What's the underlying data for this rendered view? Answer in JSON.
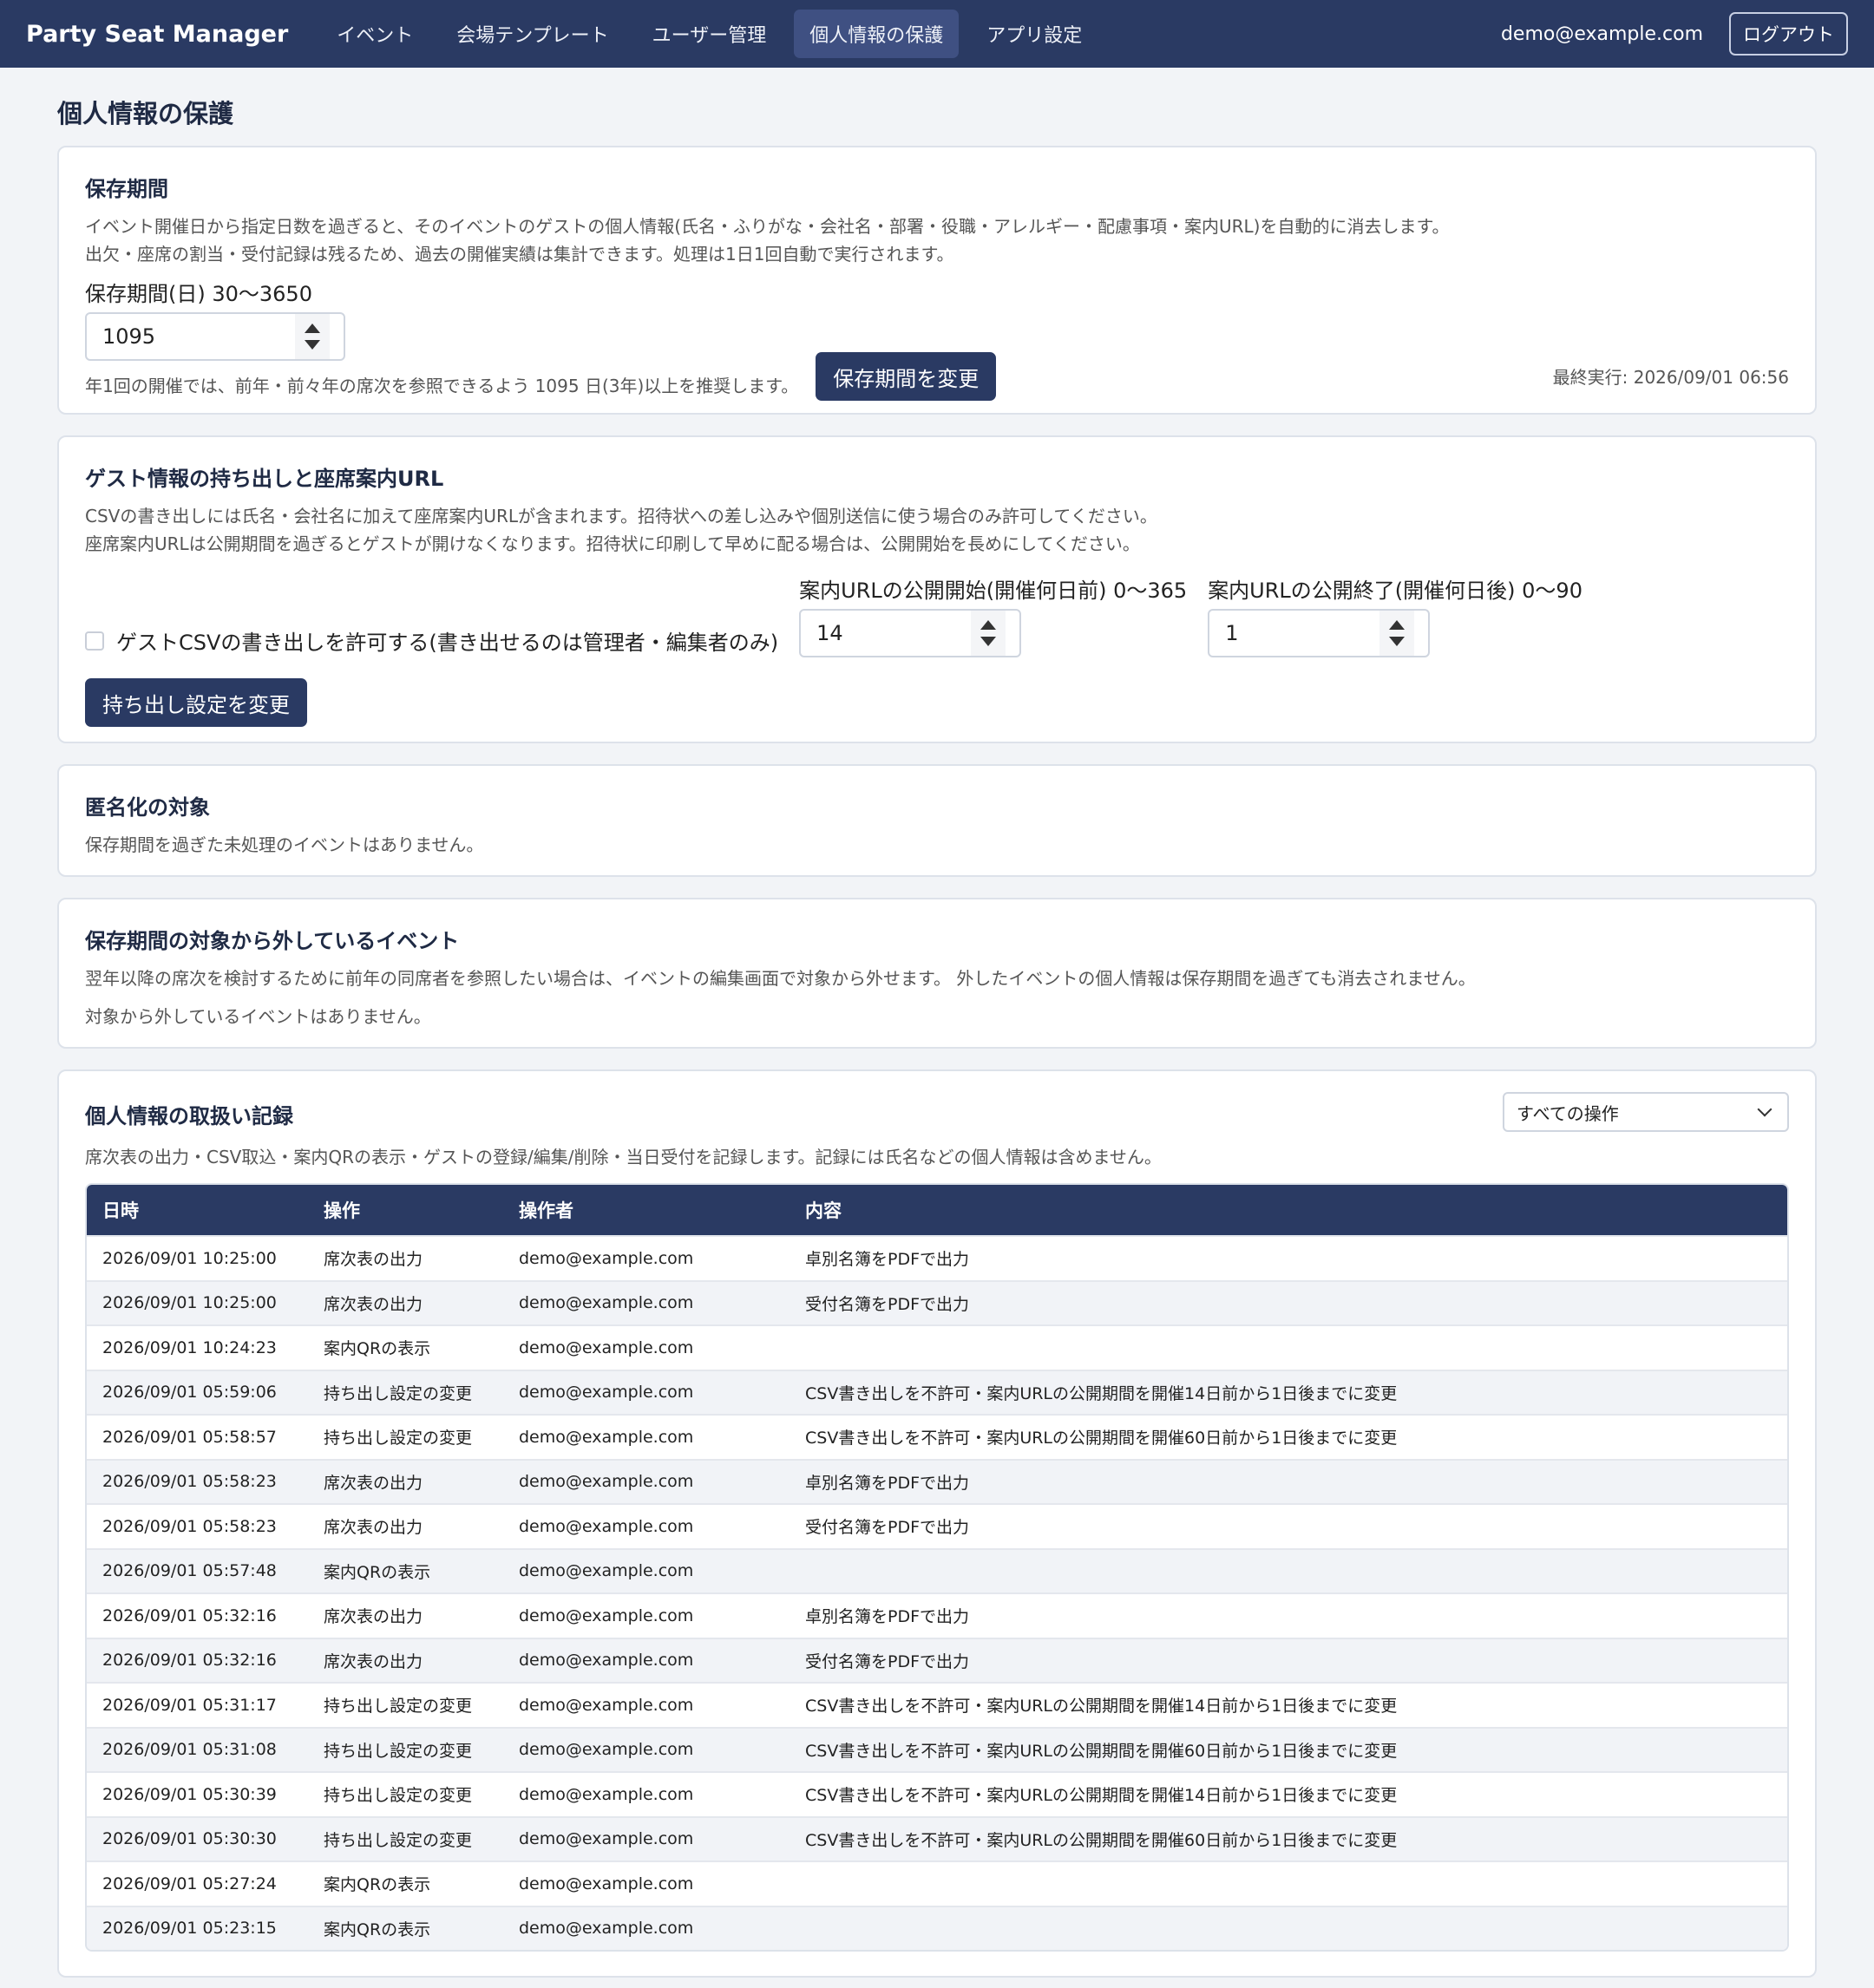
{
  "nav": {
    "brand": "Party Seat Manager",
    "items": [
      "イベント",
      "会場テンプレート",
      "ユーザー管理",
      "個人情報の保護",
      "アプリ設定"
    ],
    "active_index": 3,
    "user": "demo@example.com",
    "logout": "ログアウト"
  },
  "page_title": "個人情報の保護",
  "retention": {
    "title": "保存期間",
    "desc1": "イベント開催日から指定日数を過ぎると、そのイベントのゲストの個人情報(氏名・ふりがな・会社名・部署・役職・アレルギー・配慮事項・案内URL)を自動的に消去します。",
    "desc2": "出欠・座席の割当・受付記録は残るため、過去の開催実績は集計できます。処理は1日1回自動で実行されます。",
    "field_label": "保存期間(日) 30〜3650",
    "value": "1095",
    "hint": "年1回の開催では、前年・前々年の席次を参照できるよう 1095 日(3年)以上を推奨します。",
    "button": "保存期間を変更",
    "last_run": "最終実行: 2026/09/01 06:56"
  },
  "export": {
    "title": "ゲスト情報の持ち出しと座席案内URL",
    "desc1": "CSVの書き出しには氏名・会社名に加えて座席案内URLが含まれます。招待状への差し込みや個別送信に使う場合のみ許可してください。",
    "desc2": "座席案内URLは公開期間を過ぎるとゲストが開けなくなります。招待状に印刷して早めに配る場合は、公開開始を長めにしてください。",
    "checkbox_label": "ゲストCSVの書き出しを許可する(書き出せるのは管理者・編集者のみ)",
    "checked": false,
    "start_label": "案内URLの公開開始(開催何日前) 0〜365",
    "start_value": "14",
    "end_label": "案内URLの公開終了(開催何日後) 0〜90",
    "end_value": "1",
    "button": "持ち出し設定を変更"
  },
  "anonymize": {
    "title": "匿名化の対象",
    "desc": "保存期間を過ぎた未処理のイベントはありません。"
  },
  "excluded": {
    "title": "保存期間の対象から外しているイベント",
    "desc": "翌年以降の席次を検討するために前年の同席者を参照したい場合は、イベントの編集画面で対象から外せます。 外したイベントの個人情報は保存期間を過ぎても消去されません。",
    "empty": "対象から外しているイベントはありません。"
  },
  "log": {
    "title": "個人情報の取扱い記録",
    "filter": "すべての操作",
    "desc": "席次表の出力・CSV取込・案内QRの表示・ゲストの登録/編集/削除・当日受付を記録します。記録には氏名などの個人情報は含めません。",
    "headers": [
      "日時",
      "操作",
      "操作者",
      "内容"
    ],
    "rows": [
      [
        "2026/09/01 10:25:00",
        "席次表の出力",
        "demo@example.com",
        "卓別名簿をPDFで出力"
      ],
      [
        "2026/09/01 10:25:00",
        "席次表の出力",
        "demo@example.com",
        "受付名簿をPDFで出力"
      ],
      [
        "2026/09/01 10:24:23",
        "案内QRの表示",
        "demo@example.com",
        ""
      ],
      [
        "2026/09/01 05:59:06",
        "持ち出し設定の変更",
        "demo@example.com",
        "CSV書き出しを不許可・案内URLの公開期間を開催14日前から1日後までに変更"
      ],
      [
        "2026/09/01 05:58:57",
        "持ち出し設定の変更",
        "demo@example.com",
        "CSV書き出しを不許可・案内URLの公開期間を開催60日前から1日後までに変更"
      ],
      [
        "2026/09/01 05:58:23",
        "席次表の出力",
        "demo@example.com",
        "卓別名簿をPDFで出力"
      ],
      [
        "2026/09/01 05:58:23",
        "席次表の出力",
        "demo@example.com",
        "受付名簿をPDFで出力"
      ],
      [
        "2026/09/01 05:57:48",
        "案内QRの表示",
        "demo@example.com",
        ""
      ],
      [
        "2026/09/01 05:32:16",
        "席次表の出力",
        "demo@example.com",
        "卓別名簿をPDFで出力"
      ],
      [
        "2026/09/01 05:32:16",
        "席次表の出力",
        "demo@example.com",
        "受付名簿をPDFで出力"
      ],
      [
        "2026/09/01 05:31:17",
        "持ち出し設定の変更",
        "demo@example.com",
        "CSV書き出しを不許可・案内URLの公開期間を開催14日前から1日後までに変更"
      ],
      [
        "2026/09/01 05:31:08",
        "持ち出し設定の変更",
        "demo@example.com",
        "CSV書き出しを不許可・案内URLの公開期間を開催60日前から1日後までに変更"
      ],
      [
        "2026/09/01 05:30:39",
        "持ち出し設定の変更",
        "demo@example.com",
        "CSV書き出しを不許可・案内URLの公開期間を開催14日前から1日後までに変更"
      ],
      [
        "2026/09/01 05:30:30",
        "持ち出し設定の変更",
        "demo@example.com",
        "CSV書き出しを不許可・案内URLの公開期間を開催60日前から1日後までに変更"
      ],
      [
        "2026/09/01 05:27:24",
        "案内QRの表示",
        "demo@example.com",
        ""
      ],
      [
        "2026/09/01 05:23:15",
        "案内QRの表示",
        "demo@example.com",
        ""
      ]
    ]
  }
}
